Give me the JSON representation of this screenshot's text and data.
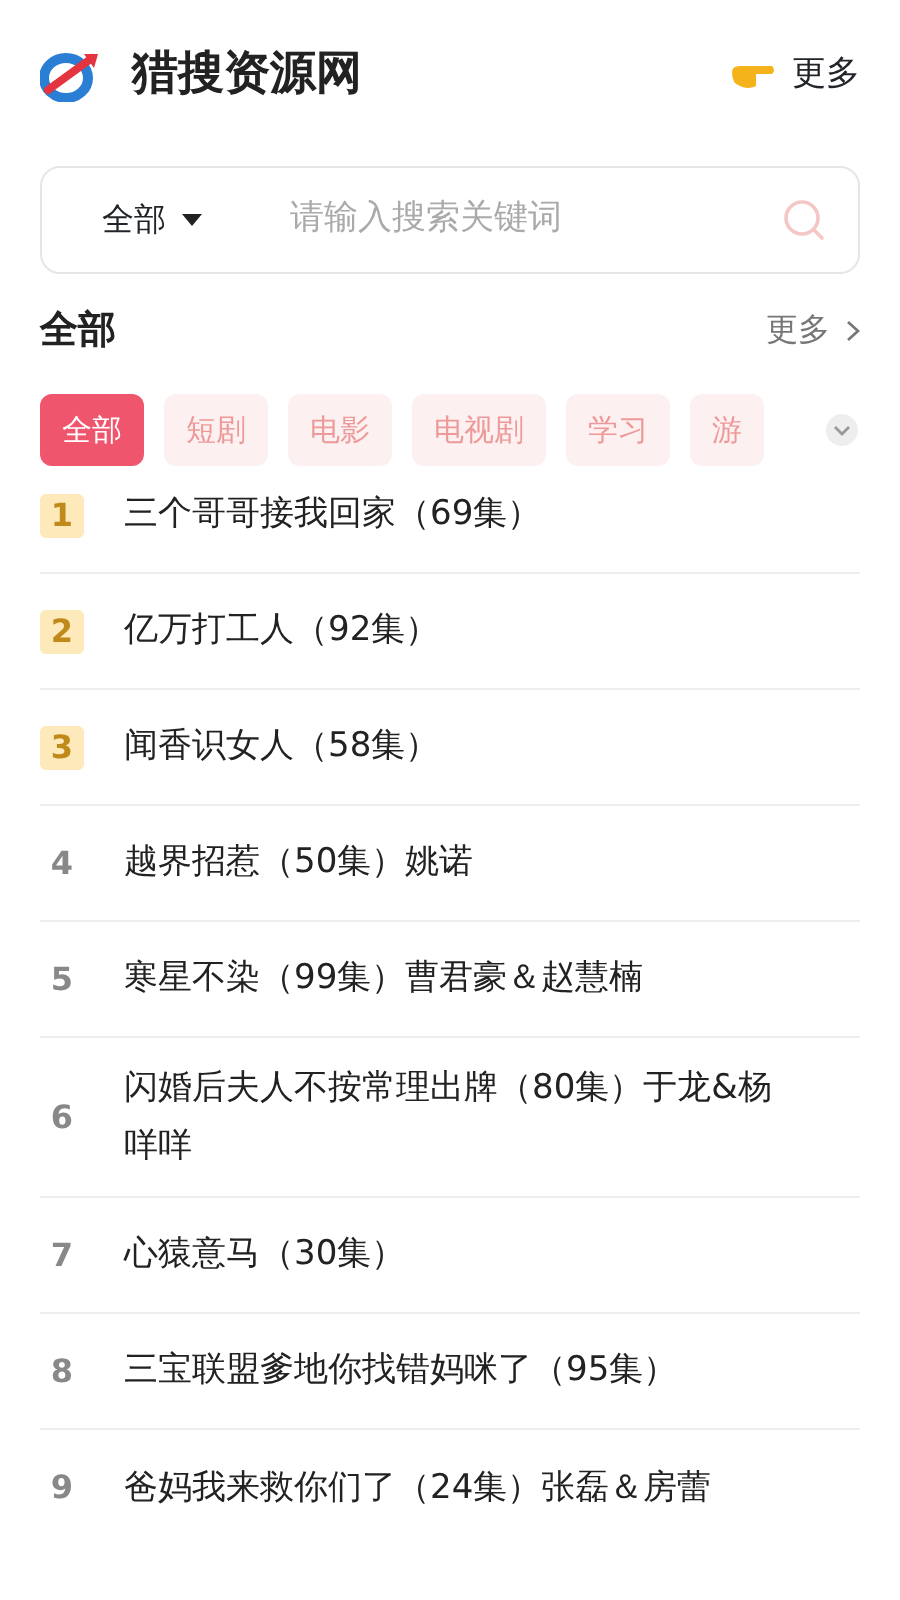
{
  "header": {
    "title": "猎搜资源网",
    "more": "更多"
  },
  "search": {
    "scope": "全部",
    "placeholder": "请输入搜索关键词"
  },
  "section": {
    "title": "全部",
    "more": "更多"
  },
  "tabs": [
    {
      "label": "全部",
      "selected": true
    },
    {
      "label": "短剧",
      "selected": false
    },
    {
      "label": "电影",
      "selected": false
    },
    {
      "label": "电视剧",
      "selected": false
    },
    {
      "label": "学习",
      "selected": false
    },
    {
      "label": "游",
      "selected": false
    }
  ],
  "items": [
    {
      "rank": "1",
      "kind": "top",
      "title": "三个哥哥接我回家（69集）"
    },
    {
      "rank": "2",
      "kind": "top",
      "title": "亿万打工人（92集）"
    },
    {
      "rank": "3",
      "kind": "top",
      "title": "闻香识女人（58集）"
    },
    {
      "rank": "4",
      "kind": "plain",
      "title": "越界招惹（50集）姚诺"
    },
    {
      "rank": "5",
      "kind": "plain",
      "title": "寒星不染（99集）曹君豪＆赵慧楠"
    },
    {
      "rank": "6",
      "kind": "plain",
      "title": "闪婚后夫人不按常理出牌（80集）于龙&杨咩咩"
    },
    {
      "rank": "7",
      "kind": "plain",
      "title": "心猿意马（30集）"
    },
    {
      "rank": "8",
      "kind": "plain",
      "title": "三宝联盟爹地你找错妈咪了（95集）"
    },
    {
      "rank": "9",
      "kind": "plain",
      "title": "爸妈我来救你们了（24集）张磊＆房蕾"
    }
  ]
}
